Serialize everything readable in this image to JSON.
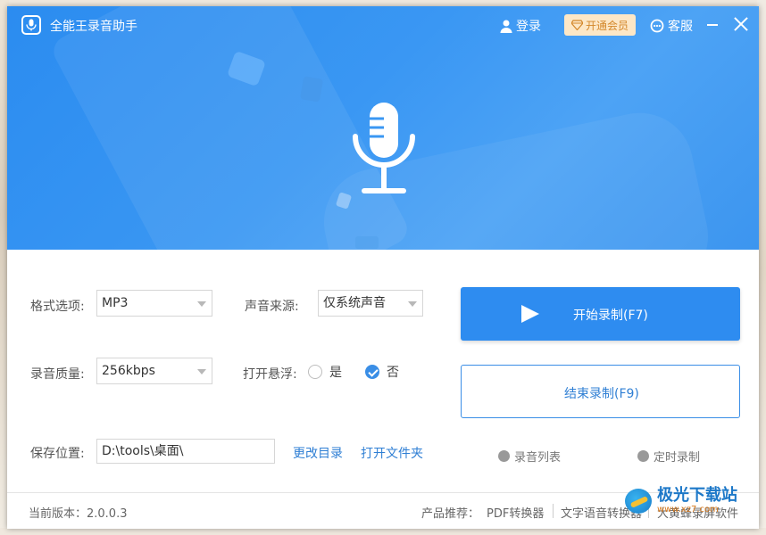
{
  "window": {
    "title": "全能王录音助手",
    "accent": "#2e8cf0"
  },
  "titlebar": {
    "login_label": "登录",
    "vip_label": "开通会员",
    "service_label": "客服",
    "icons": [
      "user-icon",
      "diamond-icon",
      "headset-icon",
      "minimize-icon",
      "close-icon"
    ]
  },
  "form": {
    "format_label": "格式选项:",
    "format_value": "MP3",
    "source_label": "声音来源:",
    "source_value": "仅系统声音",
    "quality_label": "录音质量:",
    "quality_value": "256kbps",
    "float_label": "打开悬浮:",
    "float_yes": "是",
    "float_no": "否",
    "float_selected": "否",
    "save_label": "保存位置:",
    "save_path": "D:\\tools\\桌面\\",
    "change_dir": "更改目录",
    "open_folder": "打开文件夹"
  },
  "actions": {
    "start_label": "开始录制(F7)",
    "stop_label": "结束录制(F9)",
    "list_label": "录音列表",
    "timer_label": "定时录制"
  },
  "footer": {
    "version": "当前版本：2.0.0.3",
    "recommend_label": "产品推荐：",
    "product_1": "PDF转换器",
    "product_2": "文字语音转换器",
    "product_3": "大黄蜂录屏软件"
  },
  "watermark": {
    "title": "极光下载站",
    "url": "www.xz7.com"
  }
}
